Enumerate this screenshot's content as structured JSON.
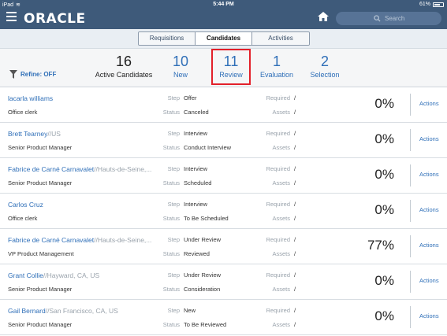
{
  "status_bar": {
    "device": "iPad",
    "time": "5:44 PM",
    "battery": "61%"
  },
  "header": {
    "logo": "ORACLE",
    "search_placeholder": "Search"
  },
  "tabs": [
    {
      "label": "Requisitions",
      "active": false
    },
    {
      "label": "Candidates",
      "active": true
    },
    {
      "label": "Activities",
      "active": false
    }
  ],
  "refine": {
    "label": "Refine: OFF"
  },
  "stats": [
    {
      "value": "16",
      "label": "Active Candidates"
    },
    {
      "value": "10",
      "label": "New"
    },
    {
      "value": "11",
      "label": "Review",
      "highlighted": true
    },
    {
      "value": "1",
      "label": "Evaluation"
    },
    {
      "value": "2",
      "label": "Selection"
    }
  ],
  "list_labels": {
    "step": "Step",
    "status": "Status",
    "required": "Required",
    "assets": "Assets",
    "actions": "Actions"
  },
  "candidates": [
    {
      "name": "lacarla williams",
      "location": "",
      "job": "Office clerk",
      "step": "Offer",
      "status": "Canceled",
      "required": "/",
      "assets": "/",
      "percent": "0%"
    },
    {
      "name": "Brett Tearney",
      "location": "//US",
      "job": "Senior Product Manager",
      "step": "Interview",
      "status": "Conduct Interview",
      "required": "/",
      "assets": "/",
      "percent": "0%"
    },
    {
      "name": "Fabrice de Carné  Carnavalet",
      "location": "//Hauts-de-Seine,...",
      "job": "Senior Product Manager",
      "step": "Interview",
      "status": "Scheduled",
      "required": "/",
      "assets": "/",
      "percent": "0%"
    },
    {
      "name": "Carlos Cruz",
      "location": "",
      "job": "Office clerk",
      "step": "Interview",
      "status": "To Be Scheduled",
      "required": "/",
      "assets": "/",
      "percent": "0%"
    },
    {
      "name": "Fabrice de Carné  Carnavalet",
      "location": "//Hauts-de-Seine,...",
      "job": "VP Product Management",
      "step": "Under Review",
      "status": "Reviewed",
      "required": "/",
      "assets": "/",
      "percent": "77%"
    },
    {
      "name": "Grant Collie",
      "location": "//Hayward, CA, US",
      "job": "Senior Product Manager",
      "step": "Under Review",
      "status": "Consideration",
      "required": "/",
      "assets": "/",
      "percent": "0%"
    },
    {
      "name": "Gail Bernard",
      "location": "//San Francisco, CA, US",
      "job": "Senior Product Manager",
      "step": "New",
      "status": "To Be Reviewed",
      "required": "/",
      "assets": "/",
      "percent": "0%"
    }
  ],
  "colors": {
    "header": "#3e5a7a",
    "link": "#2f6fb8",
    "highlight": "#e3202a"
  }
}
